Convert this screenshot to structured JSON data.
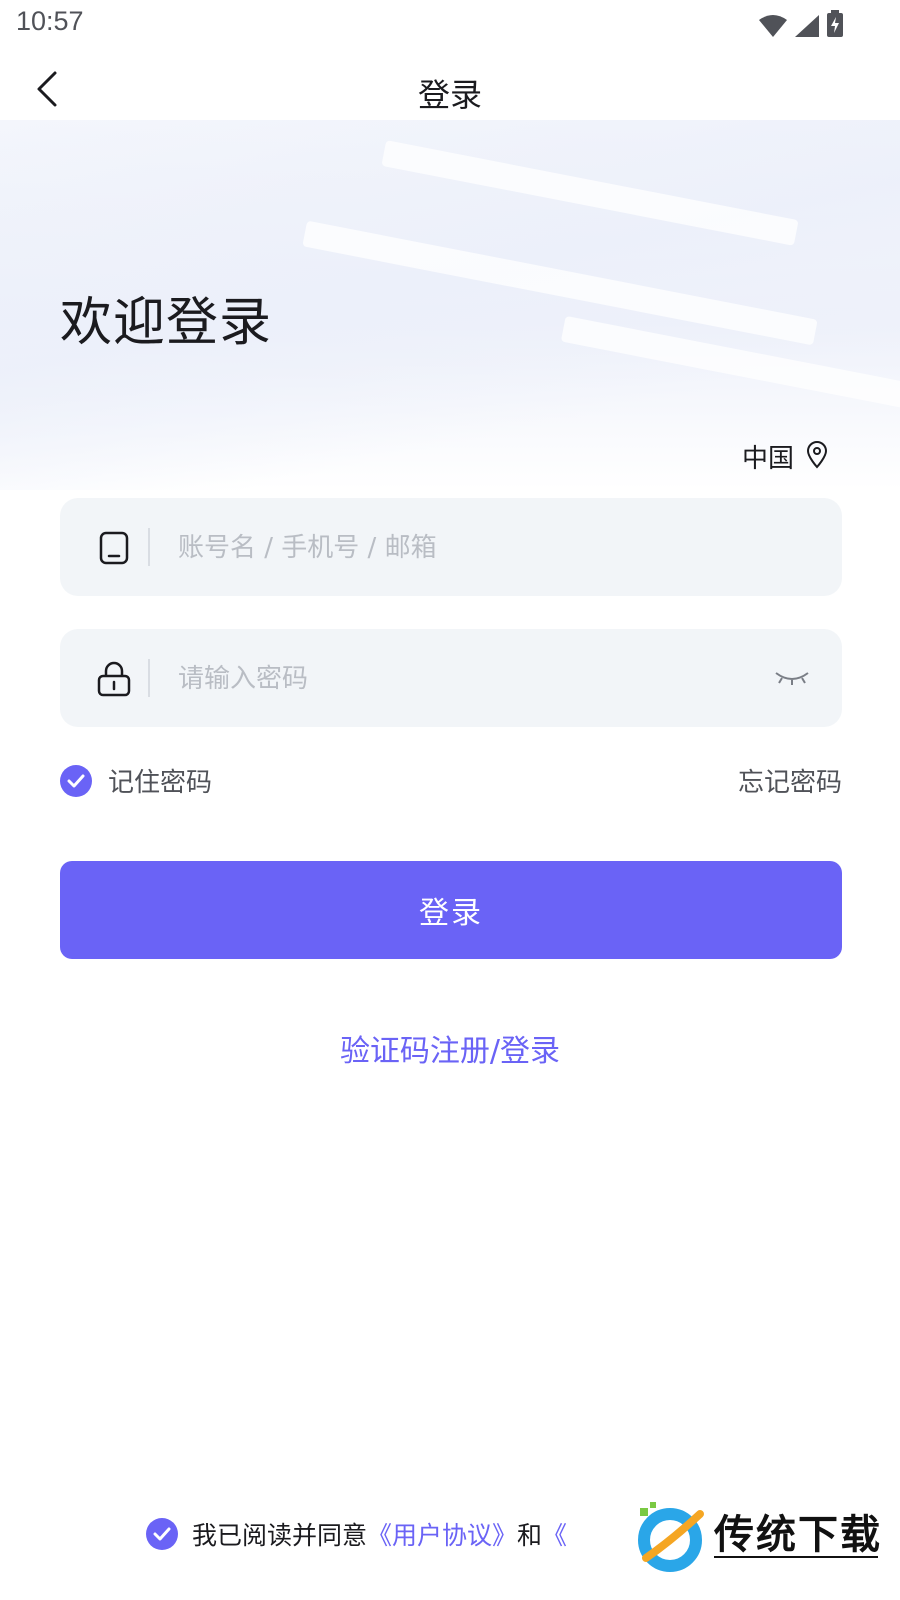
{
  "status_bar": {
    "time": "10:57",
    "icons": [
      "wifi-icon",
      "signal-icon",
      "battery-charging-icon"
    ]
  },
  "nav": {
    "title": "登录",
    "back_icon": "chevron-left-icon"
  },
  "welcome": "欢迎登录",
  "region": {
    "label": "中国",
    "icon": "location-pin-icon"
  },
  "account": {
    "placeholder": "账号名 / 手机号 / 邮箱",
    "value": "",
    "icon": "phone-icon"
  },
  "password": {
    "placeholder": "请输入密码",
    "value": "",
    "icon": "lock-icon",
    "toggle_icon": "eye-closed-icon"
  },
  "remember": {
    "label": "记住密码",
    "checked": true
  },
  "forgot_label": "忘记密码",
  "login_button": "登录",
  "sms_link": "验证码注册/登录",
  "agreement": {
    "checked": true,
    "prefix": "我已阅读并同意",
    "user_agreement": "《用户协议》",
    "and": "和",
    "privacy_partial": "《"
  },
  "colors": {
    "accent": "#6a63f6",
    "field_bg": "#f2f5f8",
    "placeholder": "#b9bdc4"
  }
}
